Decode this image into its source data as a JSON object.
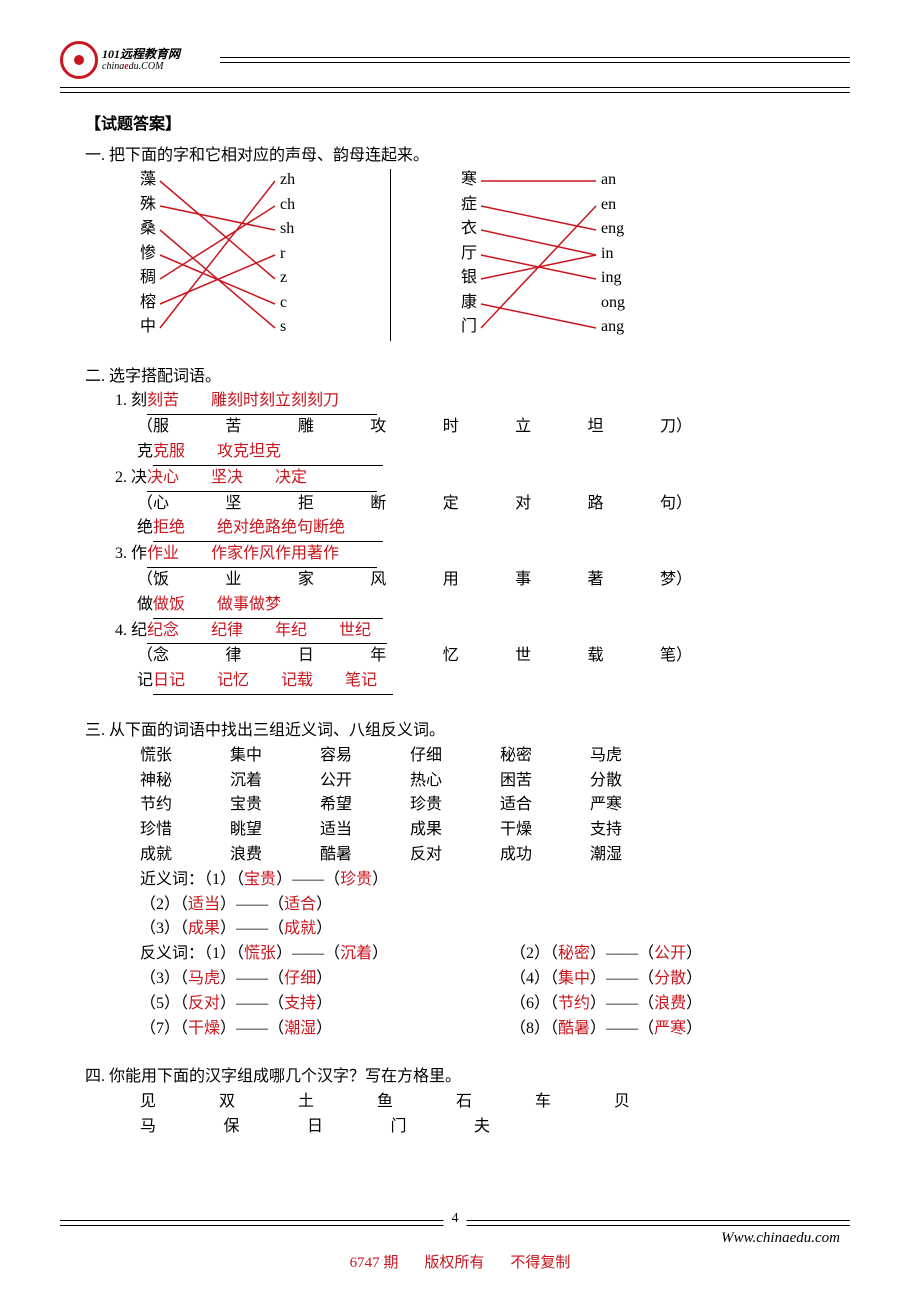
{
  "logo": {
    "brand_name": "101远程教育网",
    "subdomain": "chinaedu.com",
    "sub_e": "e"
  },
  "answerTitle": "【试题答案】",
  "q1": {
    "head": "一. 把下面的字和它相对应的声母、韵母连起来。",
    "leftChars": [
      "藻",
      "殊",
      "桑",
      "惨",
      "稠",
      "榕",
      "中"
    ],
    "leftPinyin": [
      "zh",
      "ch",
      "sh",
      "r",
      "z",
      "c",
      "s"
    ],
    "rightChars": [
      "寒",
      "症",
      "衣",
      "厅",
      "银",
      "康",
      "门"
    ],
    "rightPinyin": [
      "an",
      "en",
      "eng",
      "in",
      "ing",
      "ong",
      "ang"
    ]
  },
  "q2": {
    "head": "二. 选字搭配词语。",
    "items": [
      {
        "num": "1.",
        "baseA": "刻",
        "ansA": "刻苦　　雕刻时刻立刻刻刀",
        "optsHead": "（",
        "opts": [
          "服",
          "苦",
          "雕",
          "攻",
          "时",
          "立",
          "坦",
          "刀"
        ],
        "optsTail": "）",
        "baseB": "克",
        "ansB": "克服　　攻克坦克　　　　"
      },
      {
        "num": "2.",
        "baseA": "决",
        "ansA": "决心　　坚决　　决定",
        "optsHead": "（",
        "opts": [
          "心",
          "坚",
          "拒",
          "断",
          "定",
          "对",
          "路",
          "句"
        ],
        "optsTail": "）",
        "baseB": "绝",
        "ansB": "拒绝　　绝对绝路绝句断绝"
      },
      {
        "num": "3.",
        "baseA": "作",
        "ansA": "作业　　作家作风作用著作",
        "optsHead": "（",
        "opts": [
          "饭",
          "业",
          "家",
          "风",
          "用",
          "事",
          "著",
          "梦"
        ],
        "optsTail": "）",
        "baseB": "做",
        "ansB": "做饭　　做事做梦　　"
      },
      {
        "num": "4.",
        "baseA": "纪",
        "ansA": "纪念　　纪律　　年纪　　世纪",
        "optsHead": "（",
        "opts": [
          "念",
          "律",
          "日",
          "年",
          "忆",
          "世",
          "载",
          "笔"
        ],
        "optsTail": "）",
        "baseB": "记",
        "ansB": "日记　　记忆　　记载　　笔记"
      }
    ]
  },
  "q3": {
    "head": "三. 从下面的词语中找出三组近义词、八组反义词。",
    "grid": [
      [
        "慌张",
        "集中",
        "容易",
        "仔细",
        "秘密",
        "马虎"
      ],
      [
        "神秘",
        "沉着",
        "公开",
        "热心",
        "困苦",
        "分散"
      ],
      [
        "节约",
        "宝贵",
        "希望",
        "珍贵",
        "适合",
        "严寒"
      ],
      [
        "珍惜",
        "眺望",
        "适当",
        "成果",
        "干燥",
        "支持"
      ],
      [
        "成就",
        "浪费",
        "酷暑",
        "反对",
        "成功",
        "潮湿"
      ]
    ],
    "synLabel": "近义词：",
    "antLabel": "反义词：",
    "syn": [
      {
        "n": "（1）",
        "a": "宝贵",
        "b": "珍贵"
      },
      {
        "n": "（2）",
        "a": "适当",
        "b": "适合"
      },
      {
        "n": "（3）",
        "a": "成果",
        "b": "成就"
      }
    ],
    "ant": [
      {
        "n": "（1）",
        "a": "慌张",
        "b": "沉着"
      },
      {
        "n": "（2）",
        "a": "秘密",
        "b": "公开"
      },
      {
        "n": "（3）",
        "a": "马虎",
        "b": "仔细"
      },
      {
        "n": "（4）",
        "a": "集中",
        "b": "分散"
      },
      {
        "n": "（5）",
        "a": "反对",
        "b": "支持"
      },
      {
        "n": "（6）",
        "a": "节约",
        "b": "浪费"
      },
      {
        "n": "（7）",
        "a": "干燥",
        "b": "潮湿"
      },
      {
        "n": "（8）",
        "a": "酷暑",
        "b": "严寒"
      }
    ],
    "dash": "——"
  },
  "q4": {
    "head": "四. 你能用下面的汉字组成哪几个汉字？写在方格里。",
    "row1": [
      "见",
      "双",
      "土",
      "鱼",
      "石",
      "车",
      "贝"
    ],
    "row2": [
      "马",
      "保",
      "日",
      "门",
      "夫"
    ]
  },
  "footer": {
    "page": "4",
    "url": "Www.chinaedu.com",
    "issue": "6747 期",
    "rights": "版权所有",
    "nocopy": "不得复制"
  }
}
